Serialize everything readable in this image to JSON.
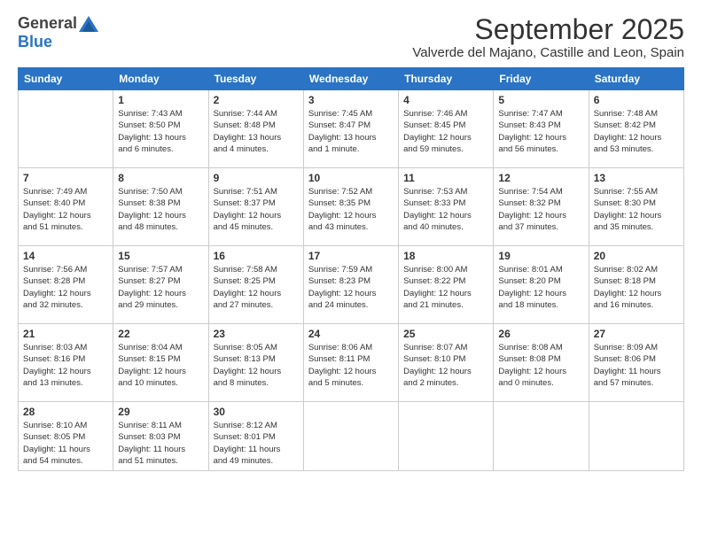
{
  "header": {
    "logo_general": "General",
    "logo_blue": "Blue",
    "month_title": "September 2025",
    "location": "Valverde del Majano, Castille and Leon, Spain"
  },
  "days_of_week": [
    "Sunday",
    "Monday",
    "Tuesday",
    "Wednesday",
    "Thursday",
    "Friday",
    "Saturday"
  ],
  "weeks": [
    [
      {
        "day": "",
        "info": ""
      },
      {
        "day": "1",
        "info": "Sunrise: 7:43 AM\nSunset: 8:50 PM\nDaylight: 13 hours\nand 6 minutes."
      },
      {
        "day": "2",
        "info": "Sunrise: 7:44 AM\nSunset: 8:48 PM\nDaylight: 13 hours\nand 4 minutes."
      },
      {
        "day": "3",
        "info": "Sunrise: 7:45 AM\nSunset: 8:47 PM\nDaylight: 13 hours\nand 1 minute."
      },
      {
        "day": "4",
        "info": "Sunrise: 7:46 AM\nSunset: 8:45 PM\nDaylight: 12 hours\nand 59 minutes."
      },
      {
        "day": "5",
        "info": "Sunrise: 7:47 AM\nSunset: 8:43 PM\nDaylight: 12 hours\nand 56 minutes."
      },
      {
        "day": "6",
        "info": "Sunrise: 7:48 AM\nSunset: 8:42 PM\nDaylight: 12 hours\nand 53 minutes."
      }
    ],
    [
      {
        "day": "7",
        "info": "Sunrise: 7:49 AM\nSunset: 8:40 PM\nDaylight: 12 hours\nand 51 minutes."
      },
      {
        "day": "8",
        "info": "Sunrise: 7:50 AM\nSunset: 8:38 PM\nDaylight: 12 hours\nand 48 minutes."
      },
      {
        "day": "9",
        "info": "Sunrise: 7:51 AM\nSunset: 8:37 PM\nDaylight: 12 hours\nand 45 minutes."
      },
      {
        "day": "10",
        "info": "Sunrise: 7:52 AM\nSunset: 8:35 PM\nDaylight: 12 hours\nand 43 minutes."
      },
      {
        "day": "11",
        "info": "Sunrise: 7:53 AM\nSunset: 8:33 PM\nDaylight: 12 hours\nand 40 minutes."
      },
      {
        "day": "12",
        "info": "Sunrise: 7:54 AM\nSunset: 8:32 PM\nDaylight: 12 hours\nand 37 minutes."
      },
      {
        "day": "13",
        "info": "Sunrise: 7:55 AM\nSunset: 8:30 PM\nDaylight: 12 hours\nand 35 minutes."
      }
    ],
    [
      {
        "day": "14",
        "info": "Sunrise: 7:56 AM\nSunset: 8:28 PM\nDaylight: 12 hours\nand 32 minutes."
      },
      {
        "day": "15",
        "info": "Sunrise: 7:57 AM\nSunset: 8:27 PM\nDaylight: 12 hours\nand 29 minutes."
      },
      {
        "day": "16",
        "info": "Sunrise: 7:58 AM\nSunset: 8:25 PM\nDaylight: 12 hours\nand 27 minutes."
      },
      {
        "day": "17",
        "info": "Sunrise: 7:59 AM\nSunset: 8:23 PM\nDaylight: 12 hours\nand 24 minutes."
      },
      {
        "day": "18",
        "info": "Sunrise: 8:00 AM\nSunset: 8:22 PM\nDaylight: 12 hours\nand 21 minutes."
      },
      {
        "day": "19",
        "info": "Sunrise: 8:01 AM\nSunset: 8:20 PM\nDaylight: 12 hours\nand 18 minutes."
      },
      {
        "day": "20",
        "info": "Sunrise: 8:02 AM\nSunset: 8:18 PM\nDaylight: 12 hours\nand 16 minutes."
      }
    ],
    [
      {
        "day": "21",
        "info": "Sunrise: 8:03 AM\nSunset: 8:16 PM\nDaylight: 12 hours\nand 13 minutes."
      },
      {
        "day": "22",
        "info": "Sunrise: 8:04 AM\nSunset: 8:15 PM\nDaylight: 12 hours\nand 10 minutes."
      },
      {
        "day": "23",
        "info": "Sunrise: 8:05 AM\nSunset: 8:13 PM\nDaylight: 12 hours\nand 8 minutes."
      },
      {
        "day": "24",
        "info": "Sunrise: 8:06 AM\nSunset: 8:11 PM\nDaylight: 12 hours\nand 5 minutes."
      },
      {
        "day": "25",
        "info": "Sunrise: 8:07 AM\nSunset: 8:10 PM\nDaylight: 12 hours\nand 2 minutes."
      },
      {
        "day": "26",
        "info": "Sunrise: 8:08 AM\nSunset: 8:08 PM\nDaylight: 12 hours\nand 0 minutes."
      },
      {
        "day": "27",
        "info": "Sunrise: 8:09 AM\nSunset: 8:06 PM\nDaylight: 11 hours\nand 57 minutes."
      }
    ],
    [
      {
        "day": "28",
        "info": "Sunrise: 8:10 AM\nSunset: 8:05 PM\nDaylight: 11 hours\nand 54 minutes."
      },
      {
        "day": "29",
        "info": "Sunrise: 8:11 AM\nSunset: 8:03 PM\nDaylight: 11 hours\nand 51 minutes."
      },
      {
        "day": "30",
        "info": "Sunrise: 8:12 AM\nSunset: 8:01 PM\nDaylight: 11 hours\nand 49 minutes."
      },
      {
        "day": "",
        "info": ""
      },
      {
        "day": "",
        "info": ""
      },
      {
        "day": "",
        "info": ""
      },
      {
        "day": "",
        "info": ""
      }
    ]
  ]
}
